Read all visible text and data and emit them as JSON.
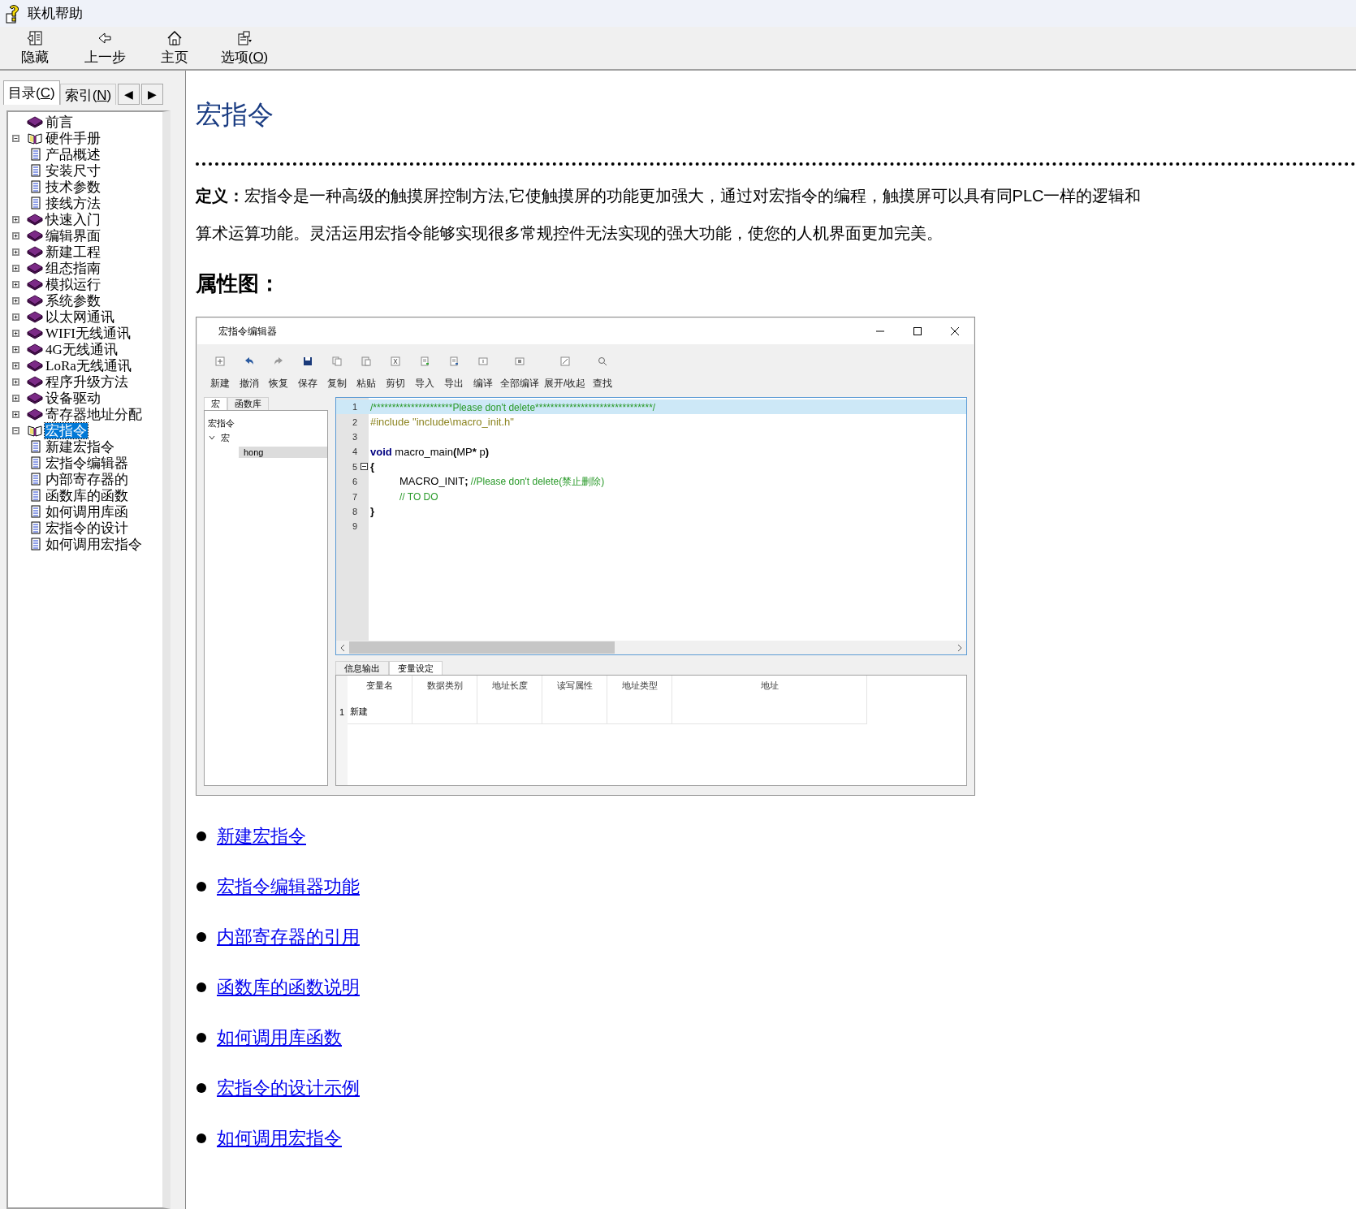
{
  "window": {
    "title": "联机帮助"
  },
  "toolbar": [
    {
      "text": "隐藏"
    },
    {
      "text": "上一步"
    },
    {
      "text": "主页"
    },
    {
      "text": "选项(",
      "accel_key": "O",
      "text_after": ")"
    }
  ],
  "nav_tabs": [
    {
      "text": "目录(",
      "accel_key": "C",
      "text_after": ")",
      "selected": true
    },
    {
      "text": "索引(",
      "accel_key": "N",
      "text_after": ")",
      "selected": false
    }
  ],
  "tab_scroll_buttons": [
    "◀",
    "▶"
  ],
  "tree": [
    {
      "label": "前言",
      "kind": "book",
      "expandable": false,
      "expanded": false,
      "selected": false
    },
    {
      "label": "硬件手册",
      "kind": "book",
      "expandable": true,
      "expanded": true,
      "selected": false,
      "children": [
        {
          "label": "产品概述",
          "kind": "page",
          "selected": false
        },
        {
          "label": "安装尺寸",
          "kind": "page",
          "selected": false
        },
        {
          "label": "技术参数",
          "kind": "page",
          "selected": false
        },
        {
          "label": "接线方法",
          "kind": "page",
          "selected": false
        }
      ]
    },
    {
      "label": "快速入门",
      "kind": "book",
      "expandable": true,
      "expanded": false,
      "selected": false
    },
    {
      "label": "编辑界面",
      "kind": "book",
      "expandable": true,
      "expanded": false,
      "selected": false
    },
    {
      "label": "新建工程",
      "kind": "book",
      "expandable": true,
      "expanded": false,
      "selected": false
    },
    {
      "label": "组态指南",
      "kind": "book",
      "expandable": true,
      "expanded": false,
      "selected": false
    },
    {
      "label": "模拟运行",
      "kind": "book",
      "expandable": true,
      "expanded": false,
      "selected": false
    },
    {
      "label": "系统参数",
      "kind": "book",
      "expandable": true,
      "expanded": false,
      "selected": false
    },
    {
      "label": "以太网通讯",
      "kind": "book",
      "expandable": true,
      "expanded": false,
      "selected": false
    },
    {
      "label": "WIFI无线通讯",
      "kind": "book",
      "expandable": true,
      "expanded": false,
      "selected": false
    },
    {
      "label": "4G无线通讯",
      "kind": "book",
      "expandable": true,
      "expanded": false,
      "selected": false
    },
    {
      "label": "LoRa无线通讯",
      "kind": "book",
      "expandable": true,
      "expanded": false,
      "selected": false
    },
    {
      "label": "程序升级方法",
      "kind": "book",
      "expandable": true,
      "expanded": false,
      "selected": false
    },
    {
      "label": "设备驱动",
      "kind": "book",
      "expandable": true,
      "expanded": false,
      "selected": false
    },
    {
      "label": "寄存器地址分配",
      "kind": "book",
      "expandable": true,
      "expanded": false,
      "selected": false
    },
    {
      "label": "宏指令",
      "kind": "book",
      "expandable": true,
      "expanded": true,
      "selected": true,
      "children": [
        {
          "label": "新建宏指令",
          "kind": "page",
          "selected": false
        },
        {
          "label": "宏指令编辑器",
          "kind": "page",
          "selected": false
        },
        {
          "label": "内部寄存器的",
          "kind": "page",
          "selected": false
        },
        {
          "label": "函数库的函数",
          "kind": "page",
          "selected": false
        },
        {
          "label": "如何调用库函",
          "kind": "page",
          "selected": false
        },
        {
          "label": "宏指令的设计",
          "kind": "page",
          "selected": false
        },
        {
          "label": "如何调用宏指令",
          "kind": "page",
          "selected": false
        }
      ]
    }
  ],
  "content": {
    "heading": "宏指令",
    "paragraph": "**定义：**宏指令是一种高级的触摸屏控制方法,它使触摸屏的功能更加强大，通过对宏指令的编程，触摸屏可以具有同PLC一样的逻辑和算术运算功能。灵活运用宏指令能够实现很多常规控件无法实现的强大功能，使您的人机界面更加完美。",
    "subheading": "属性图：",
    "editor": {
      "title": "宏指令编辑器",
      "toolbar": [
        "新建",
        "撤消",
        "恢复",
        "保存",
        "复制",
        "粘贴",
        "剪切",
        "导入",
        "导出",
        "编译",
        "全部编译",
        "展开/收起",
        "查找"
      ],
      "side_tabs": [
        {
          "label": "宏",
          "selected": true
        },
        {
          "label": "函数库",
          "selected": false
        }
      ],
      "side_tree": [
        {
          "label": "宏指令",
          "expandable": false,
          "selected": false
        },
        {
          "label": "宏",
          "expandable": true,
          "expanded": true,
          "selected": false,
          "children": [
            {
              "label": "hong",
              "selected": true
            }
          ]
        }
      ],
      "code_lines": [
        {
          "number": "1",
          "current": true,
          "fold": false,
          "indented": false,
          "segments": [
            {
              "kind": "comment",
              "text": "/*********************Please don't delete*******************************/"
            }
          ]
        },
        {
          "number": "2",
          "current": false,
          "fold": false,
          "indented": false,
          "segments": [
            {
              "kind": "preproc",
              "text": "#include \"include\\macro_init.h\""
            }
          ]
        },
        {
          "number": "3",
          "current": false,
          "fold": false
        },
        {
          "number": "4",
          "current": false,
          "fold": false,
          "indented": false,
          "segments": [
            {
              "kind": "keyword",
              "text": "void"
            },
            {
              "kind": "plain",
              "text": " macro_main"
            },
            {
              "kind": "operator",
              "text": "("
            },
            {
              "kind": "plain",
              "text": "MP"
            },
            {
              "kind": "operator",
              "text": "*"
            },
            {
              "kind": "plain",
              "text": " p"
            },
            {
              "kind": "operator",
              "text": ")"
            }
          ]
        },
        {
          "number": "5",
          "current": false,
          "fold": true,
          "indented": false,
          "segments": [
            {
              "kind": "operator",
              "text": "{"
            }
          ]
        },
        {
          "number": "6",
          "current": false,
          "fold": false,
          "indented": true,
          "segments": [
            {
              "kind": "plain",
              "text": "MACRO_INIT"
            },
            {
              "kind": "operator",
              "text": ";"
            },
            {
              "kind": "comment",
              "text": " //Please don't delete(禁止删除)"
            }
          ]
        },
        {
          "number": "7",
          "current": false,
          "fold": false,
          "indented": true,
          "segments": [
            {
              "kind": "comment",
              "text": "// TO DO"
            }
          ]
        },
        {
          "number": "8",
          "current": false,
          "fold": false,
          "indented": false,
          "segments": [
            {
              "kind": "operator",
              "text": "}"
            }
          ]
        },
        {
          "number": "9",
          "current": false,
          "fold": false
        }
      ],
      "bottom_tabs": [
        {
          "label": "信息输出",
          "selected": false
        },
        {
          "label": "变量设定",
          "selected": true
        }
      ],
      "table": {
        "columns": [
          "变量名",
          "数据类别",
          "地址长度",
          "读写属性",
          "地址类型",
          "地址"
        ],
        "rows": [
          {
            "number": "1",
            "cells": [
              "新建"
            ]
          }
        ]
      }
    },
    "links": [
      "新建宏指令",
      "宏指令编辑器功能",
      "内部寄存器的引用",
      "函数库的函数说明",
      "如何调用库函数",
      "宏指令的设计示例",
      "如何调用宏指令"
    ]
  }
}
